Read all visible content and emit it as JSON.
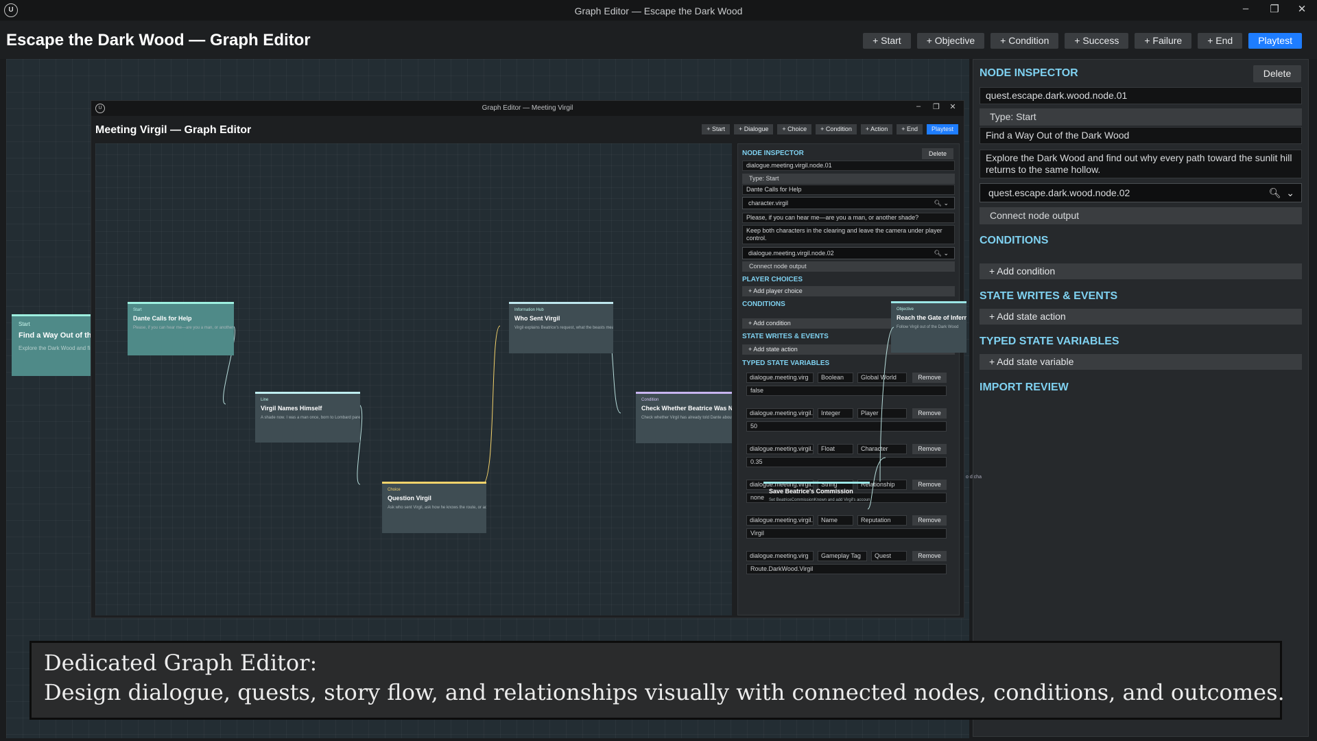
{
  "window": {
    "title": "Graph Editor — Escape the Dark Wood",
    "page_title": "Escape the Dark Wood — Graph Editor"
  },
  "toolbar": [
    "+ Start",
    "+ Objective",
    "+ Condition",
    "+ Success",
    "+ Failure",
    "+ End",
    "Playtest"
  ],
  "inspector": {
    "title": "NODE INSPECTOR",
    "delete": "Delete",
    "node_id": "quest.escape.dark.wood.node.01",
    "type": "Type: Start",
    "name": "Find a Way Out of the Dark Wood",
    "description": "Explore the Dark Wood and find out why every path toward the sunlit hill returns to the same hollow.",
    "target_node": "quest.escape.dark.wood.node.02",
    "connect_output": "Connect node output",
    "conditions_header": "CONDITIONS",
    "add_condition": "+ Add condition",
    "state_header": "STATE WRITES & EVENTS",
    "add_state_action": "+ Add state action",
    "typed_header": "TYPED STATE VARIABLES",
    "add_state_variable": "+ Add state variable",
    "import_header": "IMPORT REVIEW"
  },
  "outer_node": {
    "kind": "Start",
    "title": "Find a Way Out of the Dark Wood",
    "desc": "Explore the Dark Wood and find out why"
  },
  "nested": {
    "window_title": "Graph Editor — Meeting Virgil",
    "page_title": "Meeting Virgil — Graph Editor",
    "toolbar": [
      "+ Start",
      "+ Dialogue",
      "+ Choice",
      "+ Condition",
      "+ Action",
      "+ End",
      "Playtest"
    ],
    "nodes": [
      {
        "kind": "Start",
        "title": "Dante Calls for Help",
        "desc": "Please, if you can hear me—are you a man, or another shade?"
      },
      {
        "kind": "Line",
        "title": "Virgil Names Himself",
        "desc": "A shade now. I was a man once, born to Lombard parents, and Ma"
      },
      {
        "kind": "Choice",
        "title": "Question Virgil",
        "desc": "Ask who sent Virgil, ask how he knows the route, or admit that"
      },
      {
        "kind": "Information Hub",
        "title": "Who Sent Virgil",
        "desc": "Virgil explains Beatrice's request, what the beasts mean, and"
      },
      {
        "kind": "Condition",
        "title": "Check Whether Beatrice Was Named",
        "desc": "Check whether Virgil has already told Dante about Beatrice"
      },
      {
        "kind": "Objective",
        "title": "Reach the Gate of Inferno",
        "desc": "Follow Virgil out of the Dark Wood"
      },
      {
        "kind": "",
        "title": "Save Beatrice's Commission",
        "desc": "Set BeatriceCommissionKnown and add Virgil's account to the co"
      }
    ],
    "inspector": {
      "title": "NODE INSPECTOR",
      "delete": "Delete",
      "node_id": "dialogue.meeting.virgil.node.01",
      "type": "Type: Start",
      "name": "Dante Calls for Help",
      "speaker": "character.virgil",
      "line": "Please, if you can hear me—are you a man, or another shade?",
      "notes": "Keep both characters in the clearing and leave the camera under player control.",
      "target_node": "dialogue.meeting.virgil.node.02",
      "connect_output": "Connect node output",
      "choices_header": "PLAYER CHOICES",
      "add_choice": "+ Add player choice",
      "conditions_header": "CONDITIONS",
      "add_condition": "+ Add condition",
      "state_header": "STATE WRITES & EVENTS",
      "add_state_action": "+ Add state action",
      "typed_header": "TYPED STATE VARIABLES",
      "remove": "Remove",
      "variables": [
        {
          "name": "dialogue.meeting.virg",
          "type": "Boolean",
          "scope": "Global World",
          "value": "false"
        },
        {
          "name": "dialogue.meeting.virgil.variat",
          "type": "Integer",
          "scope": "Player",
          "value": "50"
        },
        {
          "name": "dialogue.meeting.virgil.vari",
          "type": "Float",
          "scope": "Character",
          "value": "0.35"
        },
        {
          "name": "dialogue.meeting.virgil.",
          "type": "String",
          "scope": "Relationship",
          "value": "none"
        },
        {
          "name": "dialogue.meeting.virgil.va",
          "type": "Name",
          "scope": "Reputation",
          "value": "Virgil"
        },
        {
          "name": "dialogue.meeting.virg",
          "type": "Gameplay Tag",
          "scope": "Quest",
          "value": "Route.DarkWood.Virgil"
        }
      ],
      "edge_fragment": "o d cha"
    }
  },
  "caption": {
    "line1": "Dedicated Graph Editor:",
    "line2": "Design dialogue, quests, story flow, and relationships visually with connected nodes, conditions, and outcomes."
  },
  "colors": {
    "accent": "#1e7dff",
    "section": "#7fd1f0",
    "start_node": "#4f8a88",
    "choice_edge": "#f5d36b"
  }
}
